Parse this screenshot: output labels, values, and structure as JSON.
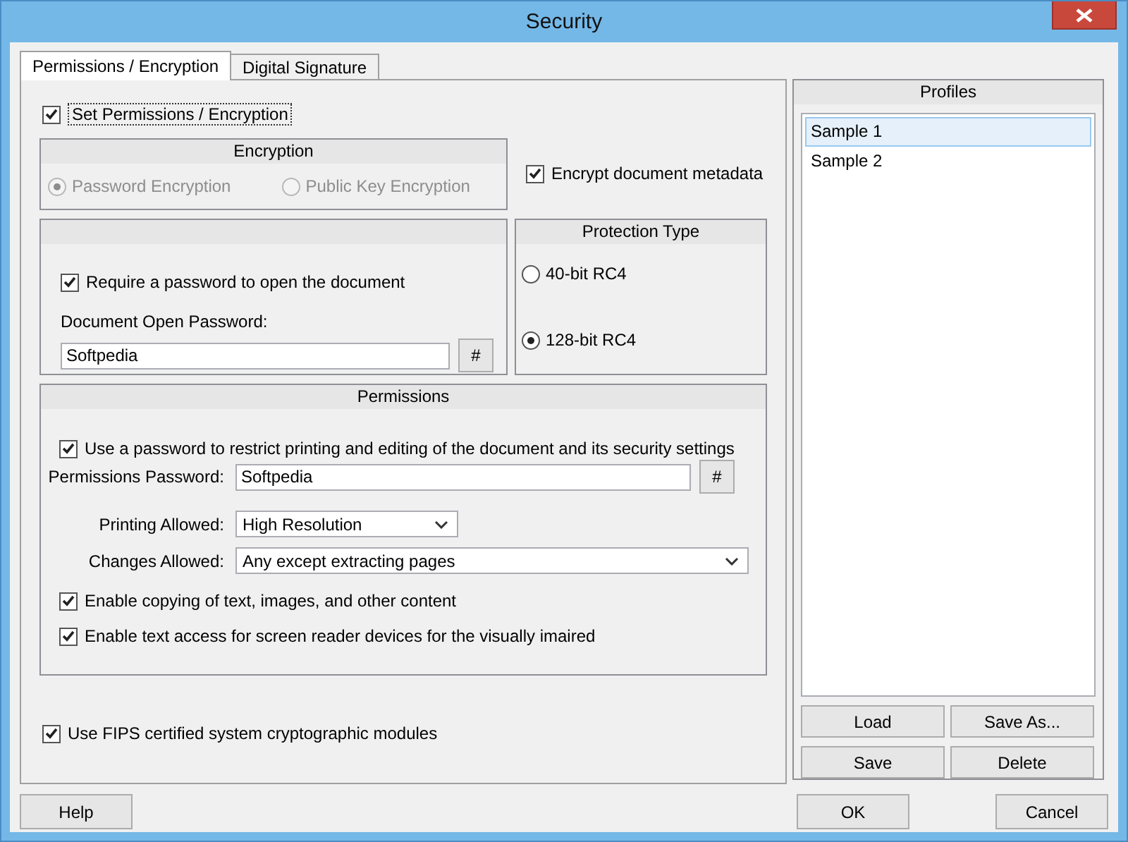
{
  "window": {
    "title": "Security"
  },
  "tabs": [
    {
      "label": "Permissions / Encryption",
      "selected": true
    },
    {
      "label": "Digital Signature",
      "selected": false
    }
  ],
  "set_permissions": {
    "label": "Set Permissions / Encryption",
    "checked": true,
    "focused": true
  },
  "encryption": {
    "title": "Encryption",
    "disabled": true,
    "options": [
      {
        "label": "Password Encryption",
        "selected": true
      },
      {
        "label": "Public Key Encryption",
        "selected": false
      }
    ]
  },
  "encrypt_metadata": {
    "label": "Encrypt document metadata",
    "checked": true
  },
  "open_password": {
    "require": {
      "label": "Require a password to open the document",
      "checked": true
    },
    "field_label": "Document Open Password:",
    "value": "Softpedia",
    "generate": "#"
  },
  "protection_type": {
    "title": "Protection Type",
    "options": [
      {
        "label": "40-bit RC4",
        "selected": false
      },
      {
        "label": "128-bit RC4",
        "selected": true
      }
    ]
  },
  "permissions": {
    "title": "Permissions",
    "use_password": {
      "label": "Use a password to restrict printing and editing of the document and its security settings",
      "checked": true
    },
    "password_label": "Permissions Password:",
    "password": "Softpedia",
    "generate": "#",
    "printing_label": "Printing Allowed:",
    "printing": "High Resolution",
    "changes_label": "Changes Allowed:",
    "changes": "Any except extracting pages",
    "options": [
      {
        "label": "Enable copying of text, images, and other content",
        "checked": true
      },
      {
        "label": "Enable text access for screen reader devices for the visually imaired",
        "checked": true
      }
    ]
  },
  "fips": {
    "label": "Use FIPS certified system cryptographic modules",
    "checked": true
  },
  "profiles": {
    "title": "Profiles",
    "items": [
      {
        "label": "Sample 1",
        "selected": true
      },
      {
        "label": "Sample 2",
        "selected": false
      }
    ],
    "buttons": [
      "Load",
      "Save As...",
      "Save",
      "Delete"
    ]
  },
  "buttons": {
    "help": "Help",
    "ok": "OK",
    "cancel": "Cancel"
  }
}
